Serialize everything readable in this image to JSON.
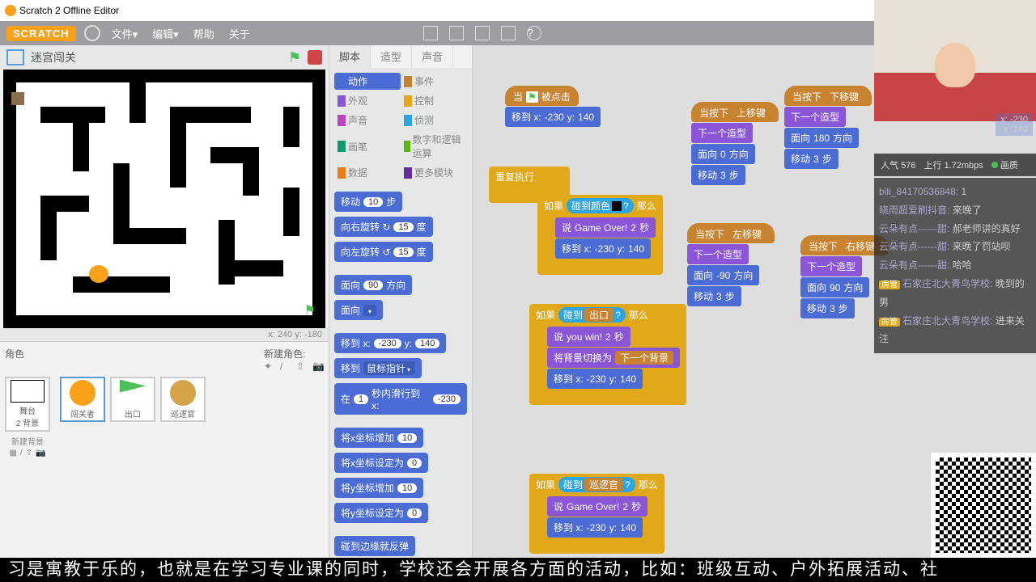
{
  "window_title": "Scratch 2 Offline Editor",
  "logo": "SCRATCH",
  "menu": {
    "file": "文件",
    "edit": "编辑",
    "help": "帮助",
    "about": "关于"
  },
  "stage_title": "迷宫闯关",
  "stage_coords": {
    "x_label": "x:",
    "x": "240",
    "y_label": "y:",
    "y": "-180"
  },
  "sprite_panel": {
    "title": "角色",
    "new_sprite": "新建角色:",
    "sprites": [
      "闯关者",
      "出口",
      "巡逻官"
    ],
    "stage_label": "舞台",
    "backdrop_count": "2 背景",
    "new_bg": "新建背景"
  },
  "tabs": {
    "scripts": "脚本",
    "costumes": "造型",
    "sounds": "声音"
  },
  "categories": {
    "motion": "动作",
    "events": "事件",
    "looks": "外观",
    "control": "控制",
    "sound": "声音",
    "sensing": "侦测",
    "pen": "画笔",
    "operators": "数字和逻辑运算",
    "data": "数据",
    "more": "更多模块"
  },
  "palette": {
    "move_steps": "移动",
    "move_steps_n": "10",
    "steps": "步",
    "turn_right": "向右旋转 ↻",
    "turn_right_n": "15",
    "deg": "度",
    "turn_left": "向左旋转 ↺",
    "turn_left_n": "15",
    "point_dir": "面向",
    "point_dir_n": "90",
    "dir_suf": "方向",
    "point_towards": "面向",
    "goto_xy": "移到 x:",
    "goto_x": "-230",
    "goto_y_lbl": "y:",
    "goto_y": "140",
    "goto_mouse": "移到",
    "mouse_ptr": "鼠标指针",
    "glide": "在",
    "glide_n": "1",
    "glide_mid": "秒内滑行到 x:",
    "glide_x": "-230",
    "change_x": "将x坐标增加",
    "change_x_n": "10",
    "set_x": "将x坐标设定为",
    "set_x_n": "0",
    "change_y": "将y坐标增加",
    "change_y_n": "10",
    "set_y": "将y坐标设定为",
    "set_y_n": "0",
    "bounce": "碰到边缘就反弹"
  },
  "scripts": {
    "flag_clicked": "当",
    "flag_clicked2": "被点击",
    "goto": "移到 x:",
    "x": "-230",
    "y_lbl": "y:",
    "y": "140",
    "forever": "重复执行",
    "if": "如果",
    "then": "那么",
    "touching_color": "碰到颜色",
    "q": "?",
    "say": "说",
    "gameover": "Game Over!",
    "secs": "2",
    "sec_unit": "秒",
    "touching": "碰到",
    "exit": "出口",
    "youwin": "you win!",
    "switch_bg": "将背景切换为",
    "next_bg": "下一个背景",
    "patrol": "巡逻官",
    "key_up": "上移键",
    "key_down": "下移键",
    "key_left": "左移键",
    "key_right": "右移键",
    "when_key": "当按下",
    "next_costume": "下一个造型",
    "point": "面向",
    "dir0": "0",
    "dir180": "180",
    "dir90": "90",
    "dirneg90": "-90",
    "dir_suf": "方向",
    "move": "移动",
    "move_n": "3",
    "steps": "步"
  },
  "overlay": {
    "coords_x": "x: -230",
    "coords_y": "y: 140",
    "popularity_label": "人气",
    "popularity": "576",
    "upload_label": "上行",
    "upload": "1.72mbps",
    "quality": "画质",
    "chat": [
      {
        "user": "bili_84170536848:",
        "msg": "1"
      },
      {
        "user": "晓雨超爱刷抖音:",
        "msg": "来晚了"
      },
      {
        "user": "云朵有点------甜:",
        "msg": "郝老师讲的真好"
      },
      {
        "user": "云朵有点------甜:",
        "msg": "来晚了罚站呗"
      },
      {
        "user": "云朵有点------甜:",
        "msg": "哈哈"
      },
      {
        "tag": "房管",
        "user": "石家庄北大青鸟学校:",
        "msg": "晚到的男"
      },
      {
        "tag": "房管",
        "user": "石家庄北大青鸟学校:",
        "msg": "进来关注"
      }
    ]
  },
  "subtitle": "习是寓教于乐的，也就是在学习专业课的同时，学校还会开展各方面的活动，比如：班级互动、户外拓展活动、社"
}
